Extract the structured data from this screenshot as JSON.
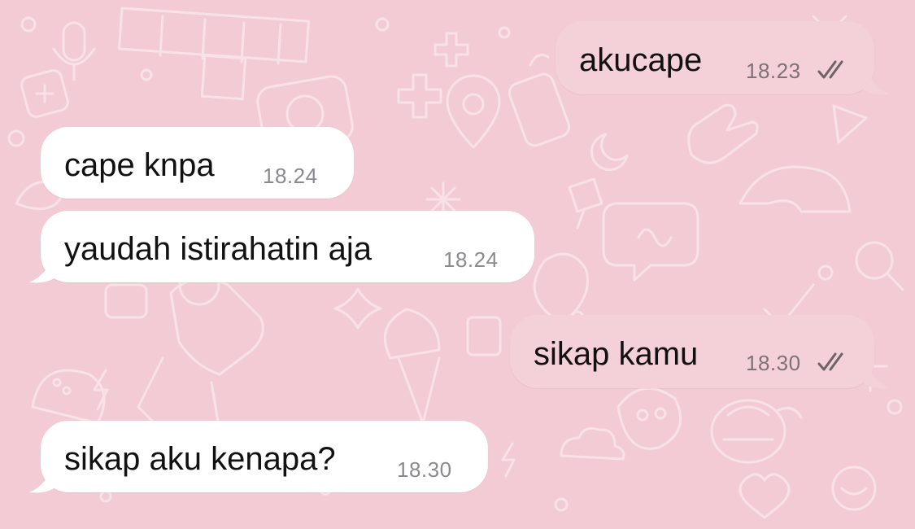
{
  "colors": {
    "wallpaper": "#f3cbd4",
    "wallpaper_doodle": "#f9e2e7",
    "incoming_bubble": "#ffffff",
    "outgoing_bubble": "#f4d0d8",
    "message_text": "#111111",
    "timestamp_text": "#8a8a8e",
    "read_ticks": "#6e6468"
  },
  "messages": [
    {
      "direction": "outgoing",
      "text": "akucape",
      "time": "18.23",
      "status_icon": "double-check-icon"
    },
    {
      "direction": "incoming",
      "text": "cape knpa",
      "time": "18.24"
    },
    {
      "direction": "incoming",
      "text": "yaudah istirahatin aja",
      "time": "18.24"
    },
    {
      "direction": "outgoing",
      "text": "sikap kamu",
      "time": "18.30",
      "status_icon": "double-check-icon"
    },
    {
      "direction": "incoming",
      "text": "sikap aku kenapa?",
      "time": "18.30"
    }
  ]
}
